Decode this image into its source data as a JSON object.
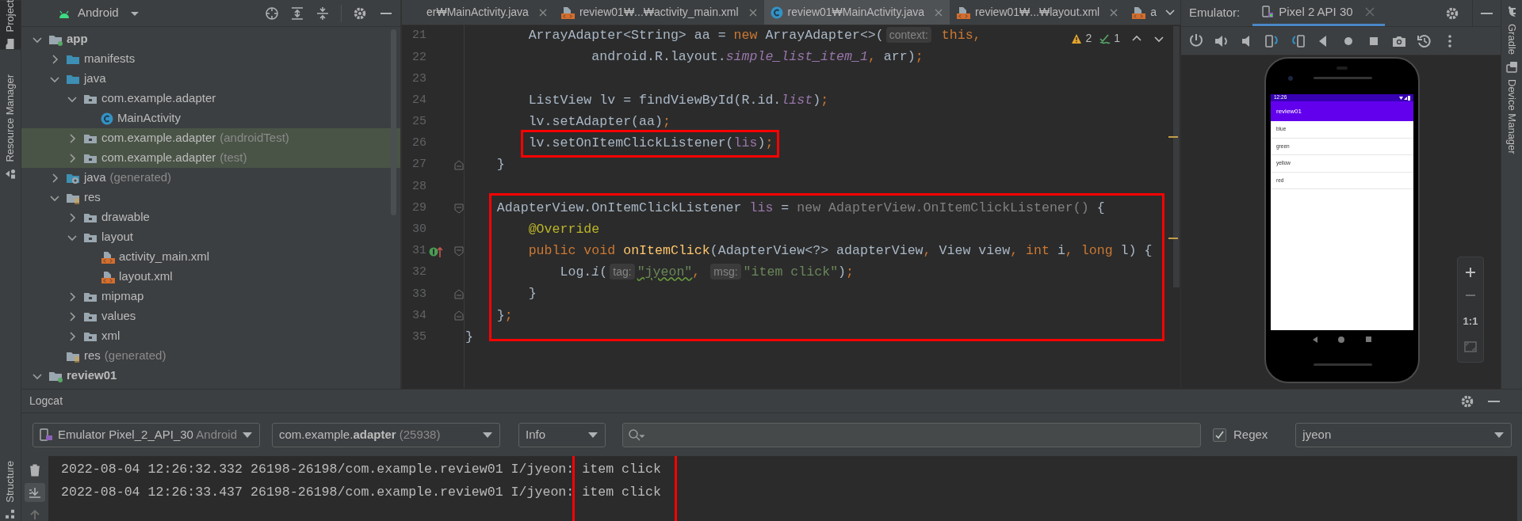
{
  "left_toolbar": [
    {
      "label": "Project",
      "selected": true
    },
    {
      "label": "Resource Manager",
      "selected": false
    }
  ],
  "left_toolbar_bottom": [
    {
      "label": "Structure",
      "selected": false
    }
  ],
  "right_toolbar": [
    {
      "label": "Gradle",
      "selected": false
    },
    {
      "label": "Device Manager",
      "selected": false
    }
  ],
  "project": {
    "view": "Android",
    "tree": [
      {
        "label": "app",
        "kind": "module",
        "expanded": true,
        "highlighted": false,
        "children": [
          {
            "label": "manifests",
            "kind": "folder",
            "expanded": false,
            "highlighted": false
          },
          {
            "label": "java",
            "kind": "folder",
            "expanded": true,
            "highlighted": false,
            "children": [
              {
                "label": "com.example.adapter",
                "kind": "package",
                "expanded": true,
                "highlighted": false,
                "children": [
                  {
                    "label": "MainActivity",
                    "kind": "class",
                    "highlighted": false
                  }
                ]
              },
              {
                "label": "com.example.adapter",
                "suffix": "(androidTest)",
                "kind": "package",
                "expanded": false,
                "highlighted": true
              },
              {
                "label": "com.example.adapter",
                "suffix": "(test)",
                "kind": "package",
                "expanded": false,
                "highlighted": true
              }
            ]
          },
          {
            "label": "java",
            "suffix": "(generated)",
            "kind": "generated_folder",
            "expanded": false,
            "highlighted": false
          },
          {
            "label": "res",
            "kind": "resource_folder",
            "expanded": true,
            "highlighted": false,
            "children": [
              {
                "label": "drawable",
                "kind": "package",
                "expanded": false,
                "highlighted": false
              },
              {
                "label": "layout",
                "kind": "package",
                "expanded": true,
                "highlighted": false,
                "children": [
                  {
                    "label": "activity_main.xml",
                    "kind": "xml",
                    "highlighted": false
                  },
                  {
                    "label": "layout.xml",
                    "kind": "xml",
                    "highlighted": false
                  }
                ]
              },
              {
                "label": "mipmap",
                "kind": "package",
                "expanded": false,
                "highlighted": false
              },
              {
                "label": "values",
                "kind": "package",
                "expanded": false,
                "highlighted": false
              },
              {
                "label": "xml",
                "kind": "package",
                "expanded": false,
                "highlighted": false
              }
            ]
          },
          {
            "label": "res",
            "suffix": "(generated)",
            "kind": "resource_folder",
            "highlighted": false
          }
        ]
      },
      {
        "label": "review01",
        "kind": "module",
        "expanded": true,
        "highlighted": false
      }
    ]
  },
  "editor": {
    "tabs": [
      {
        "label": "er₩MainActivity.java",
        "kind": "plain",
        "closable": true,
        "selected": false
      },
      {
        "label": "review01₩...₩activity_main.xml",
        "kind": "xml",
        "closable": true,
        "selected": false
      },
      {
        "label": "review01₩MainActivity.java",
        "kind": "class",
        "closable": true,
        "selected": true
      },
      {
        "label": "review01₩...₩layout.xml",
        "kind": "xml",
        "closable": true,
        "selected": false
      },
      {
        "label": "a",
        "kind": "xml",
        "closable": false,
        "selected": false
      }
    ],
    "inspections": {
      "warnings": "2",
      "weak_warnings": "1"
    },
    "lines": [
      {
        "number": "21",
        "boxed": false,
        "tokens": [
          {
            "kind": "plain",
            "text": "        ArrayAdapter<String> aa = "
          },
          {
            "kind": "keyword",
            "text": "new"
          },
          {
            "kind": "plain",
            "text": " ArrayAdapter<>("
          },
          {
            "kind": "hint",
            "text": "context:"
          },
          {
            "kind": "keyword",
            "text": " this,"
          }
        ]
      },
      {
        "number": "22",
        "boxed": false,
        "tokens": [
          {
            "kind": "plain",
            "text": "                android.R.layout."
          },
          {
            "kind": "field_italic",
            "text": "simple_list_item_1"
          },
          {
            "kind": "keyword",
            "text": ","
          },
          {
            "kind": "plain",
            "text": " arr)"
          },
          {
            "kind": "keyword",
            "text": ";"
          }
        ]
      },
      {
        "number": "23",
        "boxed": false
      },
      {
        "number": "24",
        "boxed": false,
        "tokens": [
          {
            "kind": "plain",
            "text": "        ListView lv = findViewById(R.id."
          },
          {
            "kind": "field_italic",
            "text": "list"
          },
          {
            "kind": "plain",
            "text": ")"
          },
          {
            "kind": "keyword",
            "text": ";"
          }
        ]
      },
      {
        "number": "25",
        "boxed": false,
        "tokens": [
          {
            "kind": "plain",
            "text": "        lv.setAdapter(aa)"
          },
          {
            "kind": "keyword",
            "text": ";"
          }
        ]
      },
      {
        "number": "26",
        "boxed": true,
        "tokens": [
          {
            "kind": "plain",
            "text": "        lv.setOnItemClickListener("
          },
          {
            "kind": "field",
            "text": "lis"
          },
          {
            "kind": "plain",
            "text": ")"
          },
          {
            "kind": "keyword",
            "text": ";"
          }
        ]
      },
      {
        "number": "27",
        "boxed": false,
        "gutter": [
          {
            "kind": "fold_end"
          }
        ],
        "tokens": [
          {
            "kind": "plain",
            "text": "    }"
          }
        ]
      },
      {
        "number": "28",
        "boxed": false
      },
      {
        "number": "29",
        "boxed": true,
        "gutter": [
          {
            "kind": "fold_start"
          }
        ],
        "tokens": [
          {
            "kind": "plain",
            "text": "    AdapterView.OnItemClickListener "
          },
          {
            "kind": "field",
            "text": "lis"
          },
          {
            "kind": "plain",
            "text": " = "
          },
          {
            "kind": "dim",
            "text": "new AdapterView.OnItemClickListener()"
          },
          {
            "kind": "plain",
            "text": " {"
          }
        ]
      },
      {
        "number": "30",
        "boxed": true,
        "tokens": [
          {
            "kind": "annotation",
            "text": "        @Override"
          }
        ]
      },
      {
        "number": "31",
        "boxed": true,
        "gutter": [
          {
            "kind": "override"
          },
          {
            "kind": "fold_start"
          }
        ],
        "tokens": [
          {
            "kind": "keyword",
            "text": "        public void "
          },
          {
            "kind": "method",
            "text": "onItemClick"
          },
          {
            "kind": "plain",
            "text": "(AdapterView<?> adapterView"
          },
          {
            "kind": "keyword",
            "text": ", "
          },
          {
            "kind": "plain",
            "text": "View view"
          },
          {
            "kind": "keyword",
            "text": ", int "
          },
          {
            "kind": "plain",
            "text": "i"
          },
          {
            "kind": "keyword",
            "text": ", long "
          },
          {
            "kind": "plain",
            "text": "l) {"
          }
        ]
      },
      {
        "number": "32",
        "boxed": true,
        "tokens": [
          {
            "kind": "plain",
            "text": "            Log."
          },
          {
            "kind": "italic",
            "text": "i"
          },
          {
            "kind": "plain",
            "text": "("
          },
          {
            "kind": "hint",
            "text": "tag:"
          },
          {
            "kind": "string_typo",
            "text": "\"jyeon\""
          },
          {
            "kind": "keyword",
            "text": ", "
          },
          {
            "kind": "hint",
            "text": "msg:"
          },
          {
            "kind": "string",
            "text": "\"item click\""
          },
          {
            "kind": "plain",
            "text": ")"
          },
          {
            "kind": "keyword",
            "text": ";"
          }
        ]
      },
      {
        "number": "33",
        "boxed": true,
        "gutter": [
          {
            "kind": "fold_end"
          }
        ],
        "tokens": [
          {
            "kind": "plain",
            "text": "        }"
          }
        ]
      },
      {
        "number": "34",
        "boxed": true,
        "gutter": [
          {
            "kind": "fold_end"
          }
        ],
        "tokens": [
          {
            "kind": "plain",
            "text": "    }"
          },
          {
            "kind": "keyword",
            "text": ";"
          }
        ]
      },
      {
        "number": "35",
        "boxed": false,
        "tokens": [
          {
            "kind": "plain",
            "text": "}"
          }
        ]
      }
    ]
  },
  "emulator": {
    "label": "Emulator:",
    "device_tab": {
      "label": "Pixel 2 API 30",
      "selected": true
    },
    "phone": {
      "time": "12:26",
      "app_title": "review01",
      "list": [
        "blue",
        "green",
        "yellow",
        "red"
      ]
    },
    "zoom_label": "1:1"
  },
  "logcat": {
    "title": "Logcat",
    "device": {
      "name": "Emulator Pixel_2_API_30",
      "suffix": "Android"
    },
    "process": {
      "package": "com.example.**adapter**",
      "pid": "(25938)"
    },
    "level": "Info",
    "regex": {
      "label": "Regex",
      "checked": true
    },
    "filter": "jyeon",
    "entries": [
      {
        "header": "2022-08-04 12:26:32.332 26198-26198/com.example.review01 I/jyeon:",
        "message": "item click",
        "boxed": true
      },
      {
        "header": "2022-08-04 12:26:33.437 26198-26198/com.example.review01 I/jyeon:",
        "message": "item click",
        "boxed": true
      }
    ]
  }
}
